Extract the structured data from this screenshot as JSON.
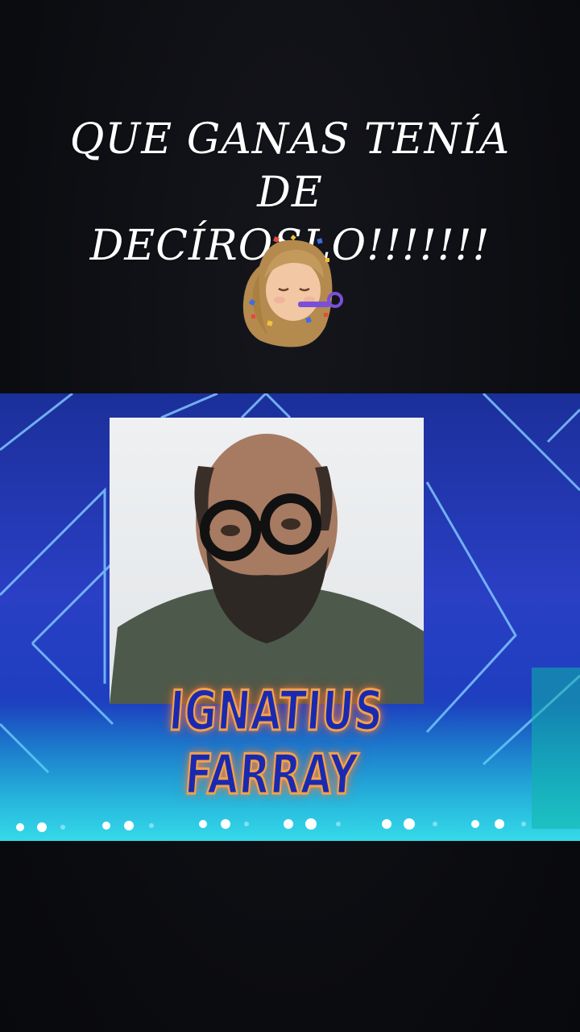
{
  "story": {
    "caption_line1": "QUE GANAS TENÍA DE",
    "caption_line2": "DECÍROSLO!!!!!!!",
    "sticker": "party-memoji-sticker"
  },
  "video": {
    "name_label": "IGNATIUS FARRAY",
    "accent_color": "#2a3fc4",
    "glow_color": "#f3a24a"
  }
}
